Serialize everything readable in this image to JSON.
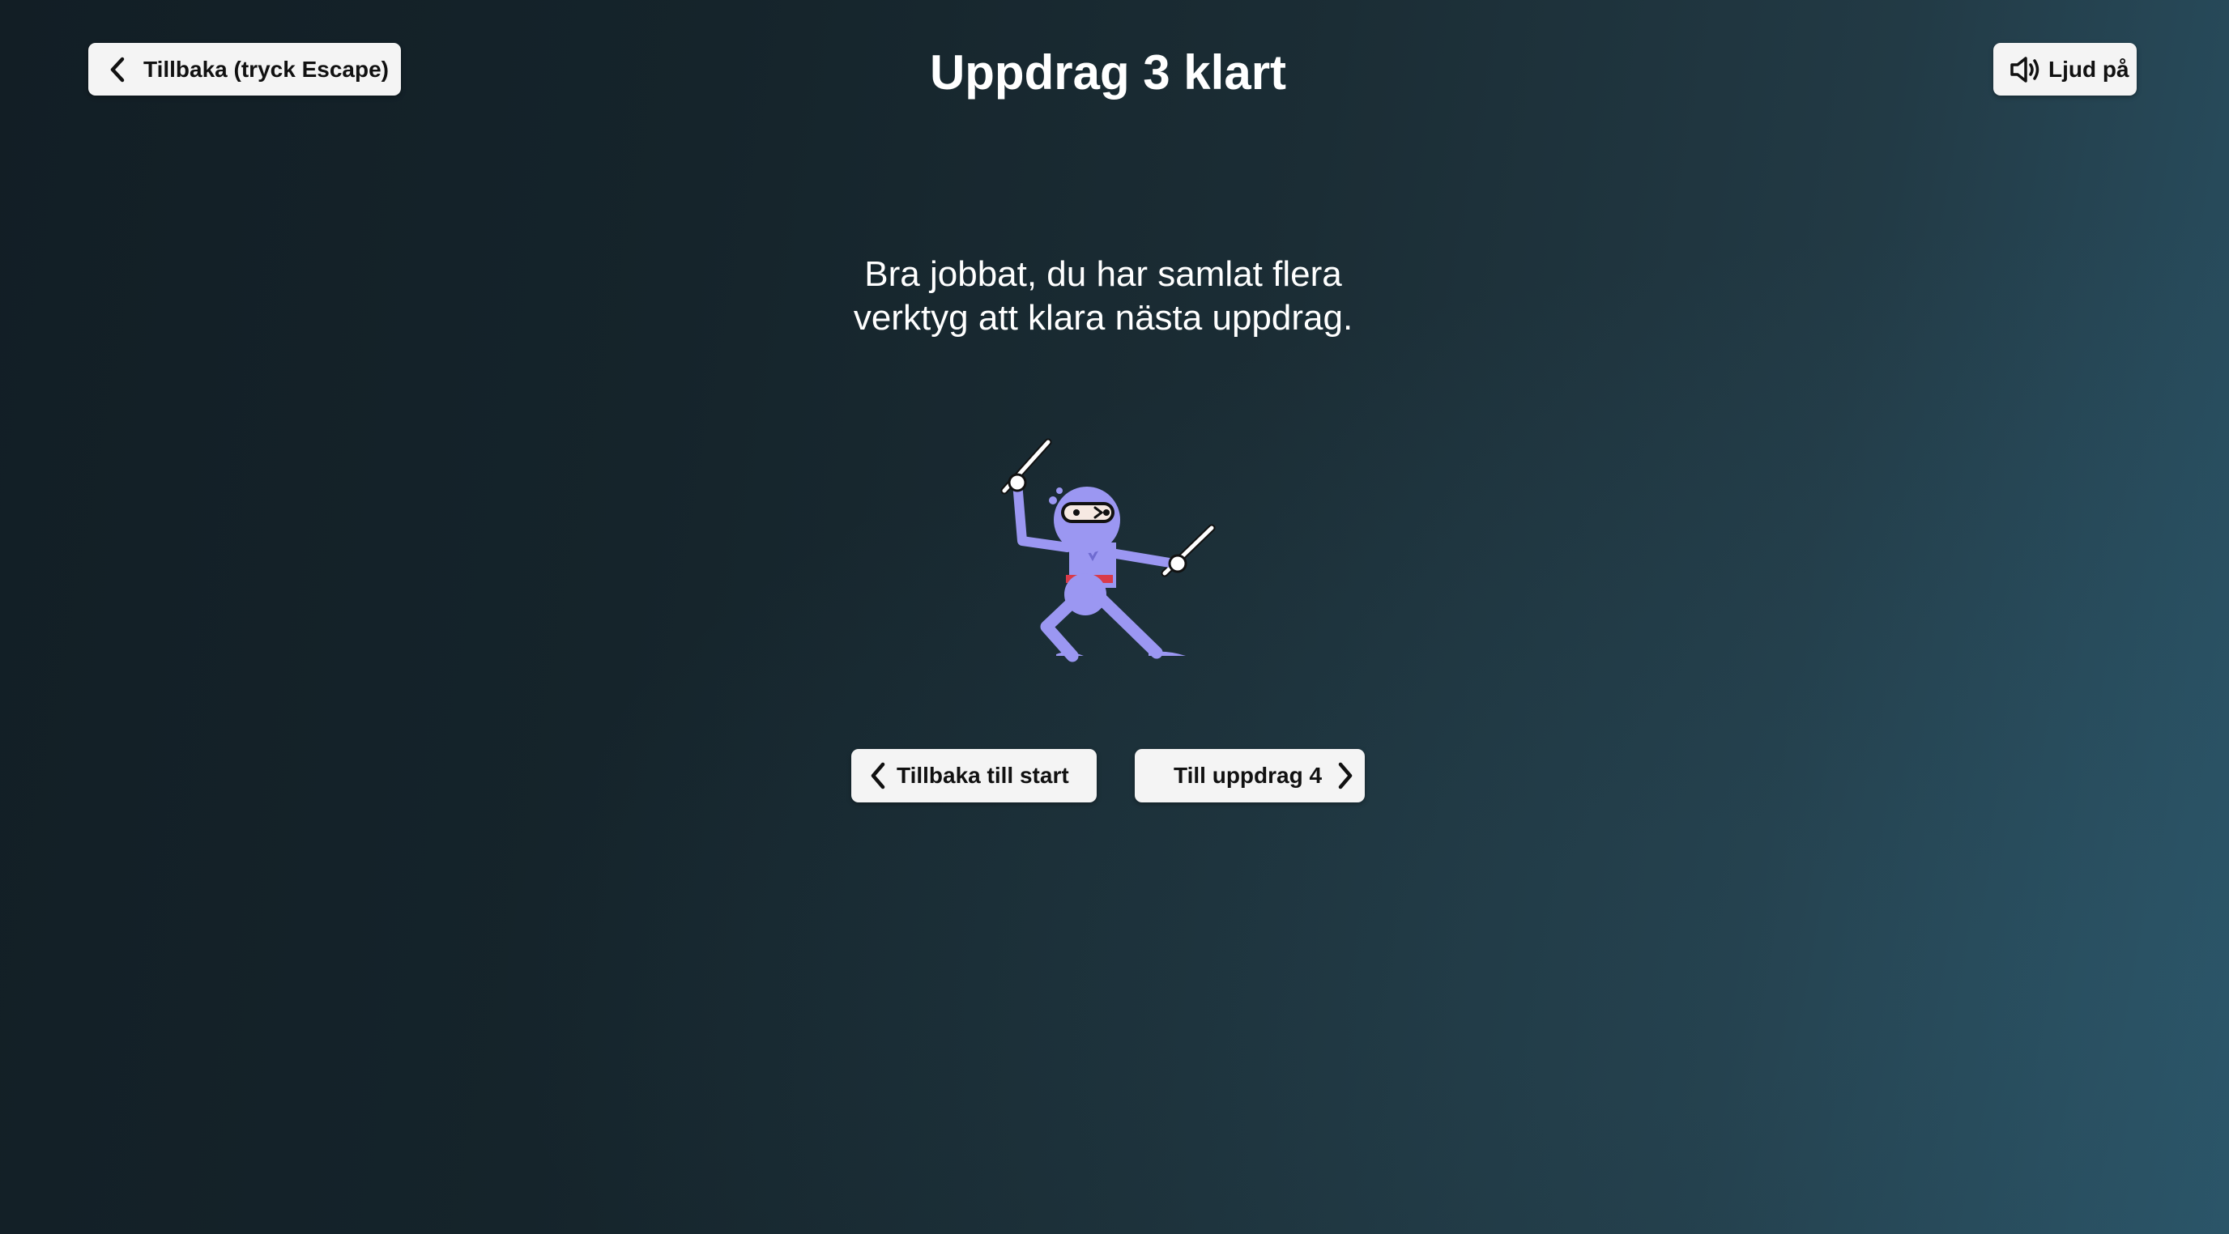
{
  "header": {
    "title": "Uppdrag 3 klart",
    "back_label": "Tillbaka (tryck Escape)",
    "sound_label": "Ljud på"
  },
  "main": {
    "message_line1": "Bra jobbat, du har samlat flera",
    "message_line2": "verktyg att klara nästa uppdrag."
  },
  "actions": {
    "start_label": "Tillbaka till start",
    "next_label": "Till uppdrag 4"
  },
  "icons": {
    "back": "chevron-left-icon",
    "sound": "speaker-icon",
    "next": "chevron-right-icon",
    "illustration": "ninja-illustration"
  },
  "colors": {
    "ninja_body": "#9b97f2",
    "ninja_belt": "#d93a4a",
    "button_bg": "#f4f4f4"
  }
}
